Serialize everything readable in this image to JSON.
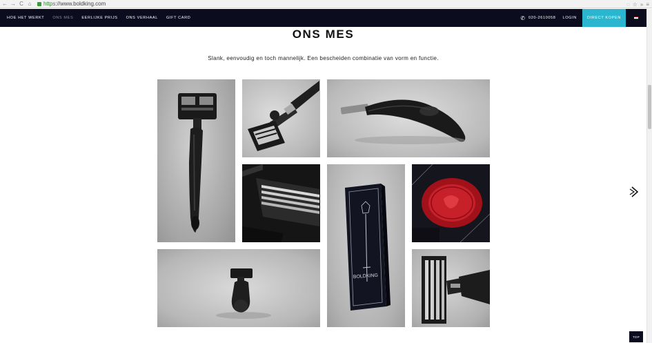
{
  "browser": {
    "url_scheme": "https",
    "url_rest": "://www.boldking.com"
  },
  "nav": {
    "links": [
      {
        "label": "HOE HET WERKT"
      },
      {
        "label": "ONS MES"
      },
      {
        "label": "EERLIJKE PRIJS"
      },
      {
        "label": "ONS VERHAAL"
      },
      {
        "label": "GIFT CARD"
      }
    ],
    "active_index": 1,
    "phone": "020-2610058",
    "login": "LOGIN",
    "buy": "DIRECT KOPEN",
    "flag_colors": [
      "#ae1c28",
      "#ffffff",
      "#21468b"
    ]
  },
  "main": {
    "title": "ONS MES",
    "subtitle": "Slank, eenvoudig en toch mannelijk. Een bescheiden combinatie van vorm en functie.",
    "box_brand": "BOLDKING"
  },
  "colors": {
    "nav_bg": "#0b0d1e",
    "accent": "#2bb6cf",
    "seal_red": "#b3141c"
  },
  "icons": {
    "next": "chevron-right-icon",
    "phone": "phone-icon"
  },
  "top_button": "TOP"
}
